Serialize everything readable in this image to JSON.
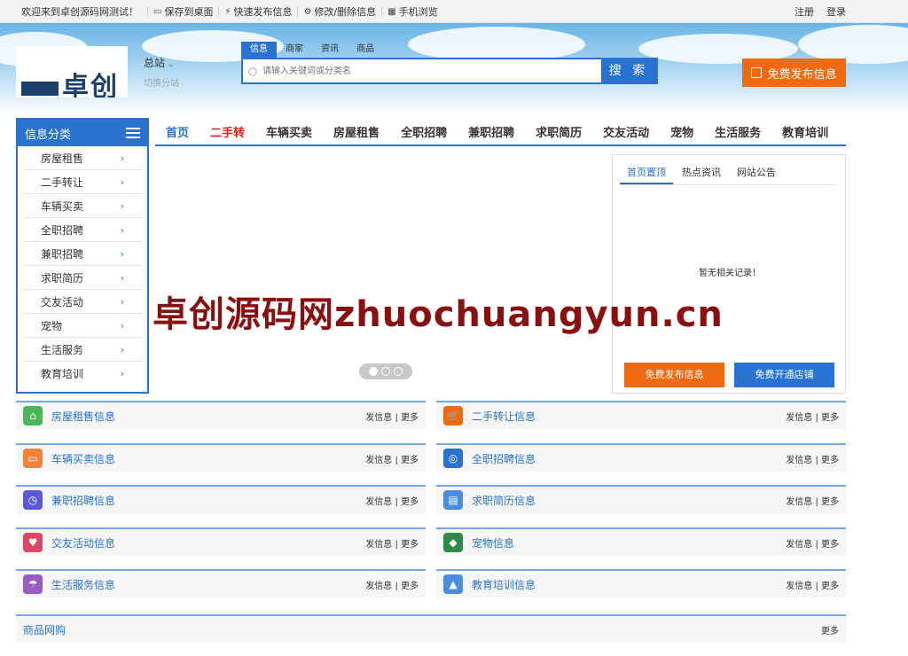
{
  "topbar": {
    "welcome": "欢迎来到卓创源码网测试！",
    "links": [
      {
        "icon": "monitor-icon",
        "label": "保存到桌面"
      },
      {
        "icon": "lightning-icon",
        "label": "快速发布信息"
      },
      {
        "icon": "gear-icon",
        "label": "修改/删除信息"
      },
      {
        "icon": "qrcode-icon",
        "label": "手机浏览"
      }
    ],
    "register": "注册",
    "login": "登录"
  },
  "header": {
    "logo_text": "卓创",
    "site_name": "总站",
    "switch_site": "切换分站",
    "search_tabs": [
      "信息",
      "商家",
      "资讯",
      "商品"
    ],
    "search_placeholder": "请输入关键词或分类名",
    "search_button": "搜 索",
    "post_button": "免费发布信息"
  },
  "sidebar": {
    "title": "信息分类",
    "items": [
      "房屋租售",
      "二手转让",
      "车辆买卖",
      "全职招聘",
      "兼职招聘",
      "求职简历",
      "交友活动",
      "宠物",
      "生活服务",
      "教育培训"
    ]
  },
  "nav": {
    "items": [
      "首页",
      "二手转",
      "车辆买卖",
      "房屋租售",
      "全职招聘",
      "兼职招聘",
      "求职简历",
      "交友活动",
      "宠物",
      "生活服务",
      "教育培训"
    ]
  },
  "infopanel": {
    "tabs": [
      "首页置顶",
      "热点资讯",
      "网站公告"
    ],
    "empty": "暂无相关记录！",
    "btn_post": "免费发布信息",
    "btn_shop": "免费开通店铺"
  },
  "watermark": "卓创源码网zhuochuangyun.cn",
  "sections": [
    {
      "title": "房屋租售信息",
      "icon": "house-icon",
      "color": "#4cb55a"
    },
    {
      "title": "二手转让信息",
      "icon": "cart-icon",
      "color": "#f26a10"
    },
    {
      "title": "车辆买卖信息",
      "icon": "car-icon",
      "color": "#f0823a"
    },
    {
      "title": "全职招聘信息",
      "icon": "person-search-icon",
      "color": "#2a72cf"
    },
    {
      "title": "兼职招聘信息",
      "icon": "clock-icon",
      "color": "#5a5ad6"
    },
    {
      "title": "求职简历信息",
      "icon": "calendar-icon",
      "color": "#4a8de0"
    },
    {
      "title": "交友活动信息",
      "icon": "heart-icon",
      "color": "#e0456a"
    },
    {
      "title": "宠物信息",
      "icon": "dog-icon",
      "color": "#2f8a4a"
    },
    {
      "title": "生活服务信息",
      "icon": "umbrella-icon",
      "color": "#9b5bc7"
    },
    {
      "title": "教育培训信息",
      "icon": "graduation-cap-icon",
      "color": "#4a8de0"
    }
  ],
  "section_actions": "发信息 | 更多",
  "goods": {
    "title": "商品网购",
    "more": "更多"
  },
  "colors": {
    "primary": "#2a72cf",
    "accent": "#f26a10",
    "hot": "#e0201b"
  }
}
